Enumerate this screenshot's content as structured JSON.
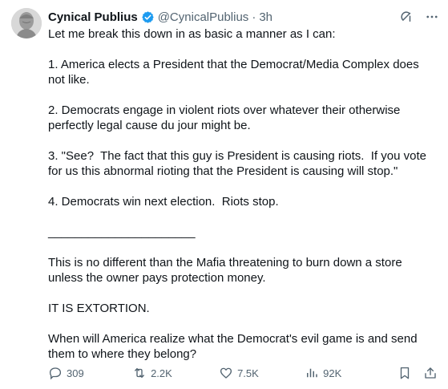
{
  "author": {
    "name": "Cynical Publius",
    "handle": "@CynicalPublius",
    "separator": "·",
    "time": "3h"
  },
  "icons": {
    "avatar": "bust-avatar",
    "verified": "verified-badge-icon",
    "grok": "grok-icon",
    "more": "more-icon",
    "reply": "reply-icon",
    "retweet": "retweet-icon",
    "like": "heart-icon",
    "views": "views-icon",
    "bookmark": "bookmark-icon",
    "share": "share-icon"
  },
  "colors": {
    "text": "#0f1419",
    "secondary": "#536471",
    "verified": "#1d9bf0"
  },
  "tweet": {
    "text": "Let me break this down in as basic a manner as I can:\n\n1. America elects a President that the Democrat/Media Complex does not like.\n\n2. Democrats engage in violent riots over whatever their otherwise perfectly legal cause du jour might be.\n\n3. \"See?  The fact that this guy is President is causing riots.  If you vote for us this abnormal rioting that the President is causing will stop.\"\n\n4. Democrats win next election.  Riots stop.\n\n______________________\n\nThis is no different than the Mafia threatening to burn down a store unless the owner pays protection money.\n\nIT IS EXTORTION.\n\nWhen will America realize what the Democrat's evil game is and send them to where they belong?"
  },
  "stats": {
    "replies": "309",
    "reposts": "2.2K",
    "likes": "7.5K",
    "views": "92K"
  }
}
